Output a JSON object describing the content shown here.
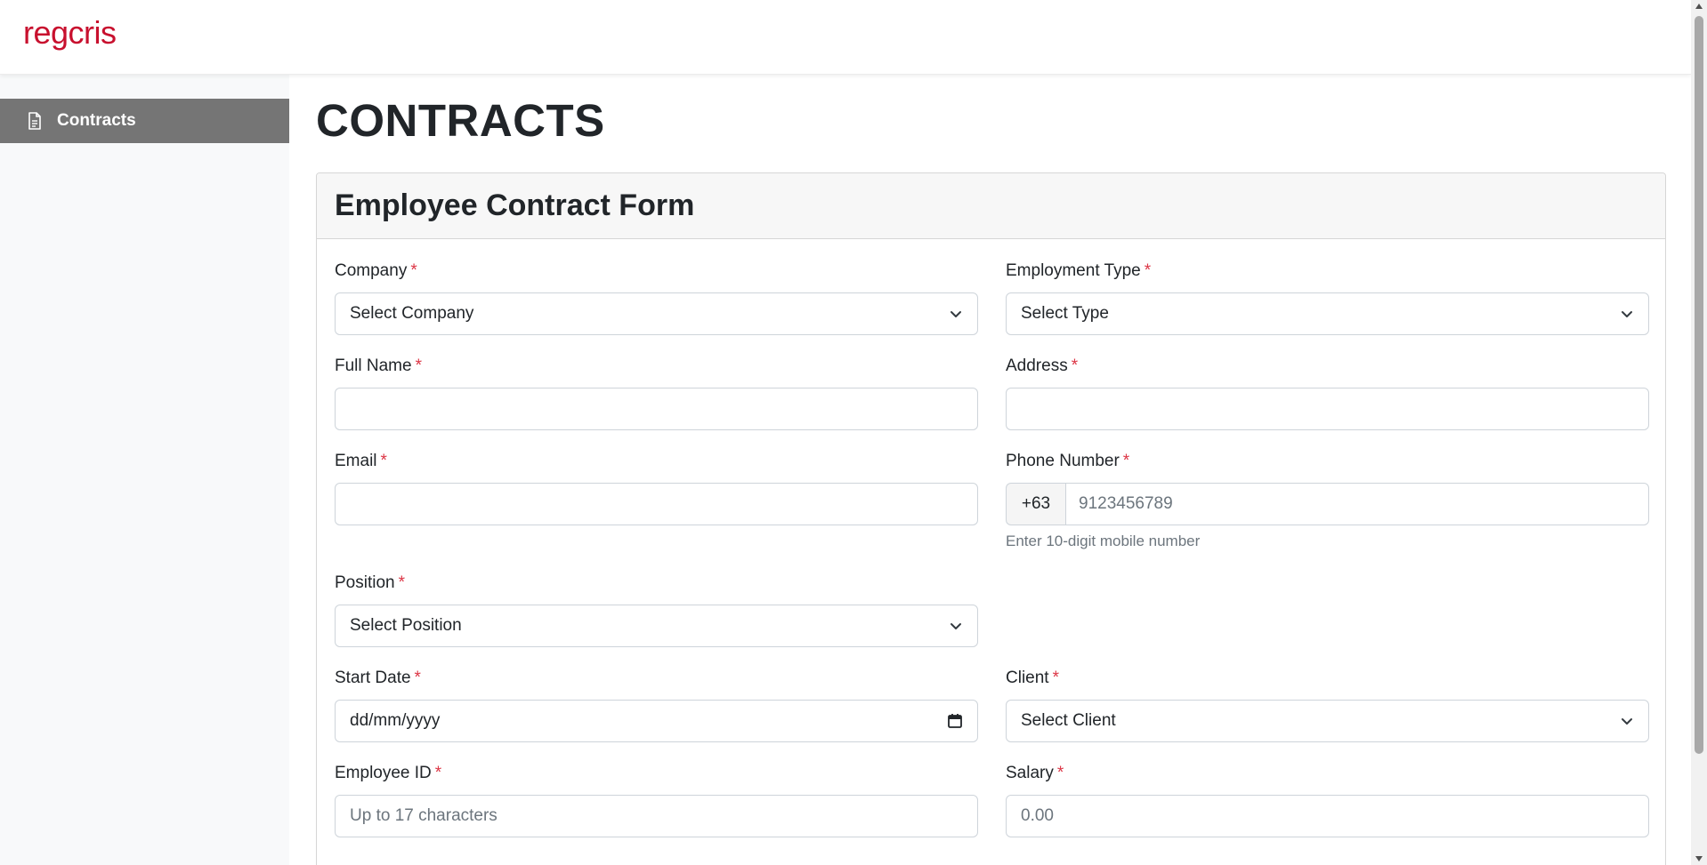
{
  "brand": {
    "logo_text": "regcris",
    "color": "#c8102e"
  },
  "sidebar": {
    "items": [
      {
        "label": "Contracts",
        "icon": "document-icon",
        "active": true
      }
    ]
  },
  "page": {
    "title": "CONTRACTS"
  },
  "form": {
    "title": "Employee Contract Form",
    "required_mark": "*",
    "company": {
      "label": "Company",
      "value": "Select Company"
    },
    "employment_type": {
      "label": "Employment Type",
      "value": "Select Type"
    },
    "full_name": {
      "label": "Full Name",
      "value": ""
    },
    "address": {
      "label": "Address",
      "value": ""
    },
    "email": {
      "label": "Email",
      "value": ""
    },
    "phone": {
      "label": "Phone Number",
      "prefix": "+63",
      "placeholder": "9123456789",
      "help": "Enter 10-digit mobile number"
    },
    "position": {
      "label": "Position",
      "value": "Select Position"
    },
    "start_date": {
      "label": "Start Date",
      "placeholder": "dd/mm/yyyy"
    },
    "client": {
      "label": "Client",
      "value": "Select Client"
    },
    "employee_id": {
      "label": "Employee ID",
      "placeholder": "Up to 17 characters"
    },
    "salary": {
      "label": "Salary",
      "placeholder": "0.00"
    }
  }
}
